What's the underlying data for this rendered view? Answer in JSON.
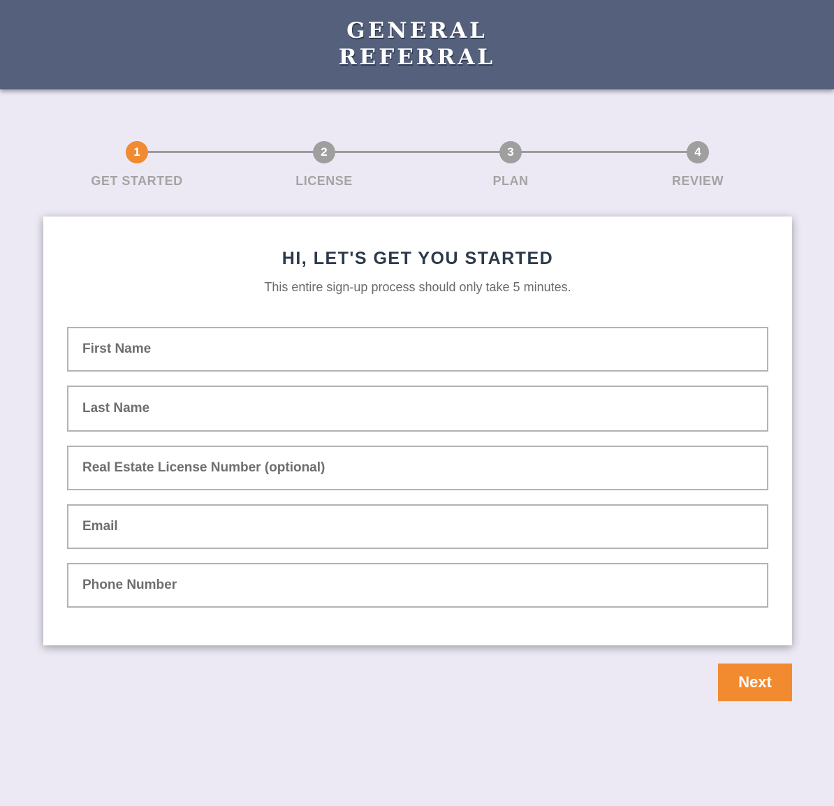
{
  "header": {
    "logo_line1": "GENERAL",
    "logo_line2": "REFERRAL",
    "background_color": "#54607c"
  },
  "stepper": {
    "active_step": 1,
    "active_color": "#f08a33",
    "inactive_color": "#a09f9f",
    "steps": [
      {
        "number": "1",
        "label": "GET STARTED"
      },
      {
        "number": "2",
        "label": "LICENSE"
      },
      {
        "number": "3",
        "label": "PLAN"
      },
      {
        "number": "4",
        "label": "REVIEW"
      }
    ]
  },
  "form": {
    "title": "HI, LET'S GET YOU STARTED",
    "subtitle": "This entire sign-up process should only take 5 minutes.",
    "fields": [
      {
        "name": "first-name",
        "placeholder": "First Name",
        "value": ""
      },
      {
        "name": "last-name",
        "placeholder": "Last Name",
        "value": ""
      },
      {
        "name": "license-number",
        "placeholder": "Real Estate License Number (optional)",
        "value": ""
      },
      {
        "name": "email",
        "placeholder": "Email",
        "value": ""
      },
      {
        "name": "phone-number",
        "placeholder": "Phone Number",
        "value": ""
      }
    ]
  },
  "actions": {
    "next_label": "Next",
    "next_color": "#f28b30"
  }
}
